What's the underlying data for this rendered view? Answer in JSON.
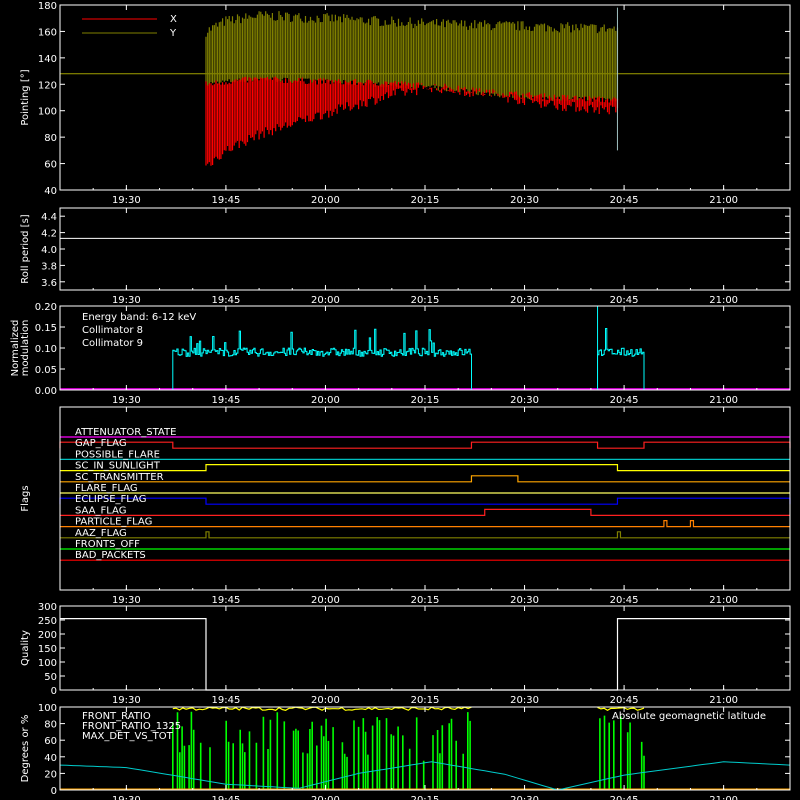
{
  "x_ticks": [
    "19:30",
    "19:45",
    "20:00",
    "20:15",
    "20:30",
    "20:45",
    "21:00"
  ],
  "chart_data": [
    {
      "type": "line",
      "title": "",
      "ylabel": "Pointing [°]",
      "ylim": [
        40,
        180
      ],
      "y_ticks": [
        "40",
        "60",
        "80",
        "100",
        "120",
        "140",
        "160",
        "180"
      ],
      "legend": "top-left",
      "series": [
        {
          "name": "X",
          "color": "#ff0000",
          "x": [
            "19:42",
            "19:45",
            "19:50",
            "20:00",
            "20:10",
            "20:16",
            "20:25",
            "20:35",
            "20:44"
          ],
          "y_upper": [
            120,
            122,
            124,
            122,
            121,
            118,
            114,
            110,
            108
          ],
          "y_lower": [
            58,
            70,
            82,
            98,
            112,
            118,
            112,
            104,
            100
          ]
        },
        {
          "name": "Y",
          "color": "#808000",
          "x": [
            "19:42",
            "19:45",
            "19:50",
            "20:00",
            "20:15",
            "20:30",
            "20:44"
          ],
          "y_upper": [
            160,
            168,
            172,
            170,
            166,
            164,
            162
          ],
          "y_lower": [
            120,
            122,
            124,
            122,
            118,
            110,
            108
          ]
        }
      ],
      "baseline": 128
    },
    {
      "type": "line",
      "ylabel": "Roll period [s]",
      "ylim": [
        3.5,
        4.5
      ],
      "y_ticks": [
        "3.6",
        "3.8",
        "4.0",
        "4.2",
        "4.4"
      ],
      "series": [
        {
          "name": "",
          "color": "#ffffff",
          "x": [
            "19:20",
            "21:10"
          ],
          "y": [
            4.13,
            4.13
          ]
        }
      ]
    },
    {
      "type": "line",
      "ylabel": "Normalized modulation",
      "ylim": [
        0,
        0.2
      ],
      "y_ticks": [
        "0.00",
        "0.05",
        "0.10",
        "0.15",
        "0.20"
      ],
      "legend": "top-left",
      "annotation": "Energy band: 6-12 keV",
      "series": [
        {
          "name": "Collimator 8",
          "color": "#00ffff",
          "segments": [
            {
              "x": [
                "19:37",
                "20:22"
              ],
              "y_mean": 0.09
            },
            {
              "x": [
                "20:41",
                "20:48"
              ],
              "y_mean": 0.09
            }
          ]
        },
        {
          "name": "Collimator 9",
          "color": "#ff00ff",
          "x": [
            "19:20",
            "21:10"
          ],
          "y": [
            0,
            0
          ]
        }
      ]
    },
    {
      "type": "table",
      "ylabel": "Flags",
      "flags": [
        {
          "name": "ATTENUATOR_STATE",
          "color": "#ff00ff",
          "on": []
        },
        {
          "name": "GAP_FLAG",
          "color": "#ff2020",
          "on": [
            [
              "19:20",
              "19:37"
            ],
            [
              "20:22",
              "20:41"
            ],
            [
              "20:48",
              "21:10"
            ]
          ]
        },
        {
          "name": "POSSIBLE_FLARE",
          "color": "#00c0c0",
          "on": []
        },
        {
          "name": "SC_IN_SUNLIGHT",
          "color": "#ffff00",
          "on": [
            [
              "19:42",
              "20:44"
            ]
          ]
        },
        {
          "name": "SC_TRANSMITTER",
          "color": "#ffa500",
          "on": [
            [
              "20:22",
              "20:29"
            ]
          ]
        },
        {
          "name": "FLARE_FLAG",
          "color": "#ffff60",
          "on": []
        },
        {
          "name": "ECLIPSE_FLAG",
          "color": "#0000ff",
          "on": [
            [
              "19:20",
              "19:42"
            ],
            [
              "20:44",
              "21:10"
            ]
          ]
        },
        {
          "name": "SAA_FLAG",
          "color": "#ff2020",
          "on": [
            [
              "20:24",
              "20:40"
            ]
          ]
        },
        {
          "name": "PARTICLE_FLAG",
          "color": "#ff8000",
          "on": [
            [
              "20:51",
              "20:51"
            ],
            [
              "20:55",
              "20:55"
            ]
          ]
        },
        {
          "name": "AAZ_FLAG",
          "color": "#808000",
          "on": [
            [
              "19:42",
              "19:42"
            ],
            [
              "20:44",
              "20:44"
            ]
          ]
        },
        {
          "name": "FRONTS_OFF",
          "color": "#00ff00",
          "on": []
        },
        {
          "name": "BAD_PACKETS",
          "color": "#ff0000",
          "on": []
        }
      ]
    },
    {
      "type": "line",
      "ylabel": "Quality",
      "ylim": [
        0,
        300
      ],
      "y_ticks": [
        "0",
        "50",
        "100",
        "150",
        "200",
        "250",
        "300"
      ],
      "series": [
        {
          "name": "",
          "color": "#ffffff",
          "x": [
            "19:20",
            "19:42",
            "19:42",
            "20:44",
            "20:44",
            "21:10"
          ],
          "y": [
            255,
            255,
            0,
            0,
            255,
            255
          ]
        }
      ]
    },
    {
      "type": "bar",
      "ylabel": "Degrees or %",
      "ylim": [
        0,
        100
      ],
      "y_ticks": [
        "0",
        "20",
        "40",
        "60",
        "80",
        "100"
      ],
      "legend": "top-left",
      "annotation": "Absolute geomagnetic latitude",
      "series": [
        {
          "name": "FRONT_RATIO",
          "color": "#ffff00",
          "segments": [
            [
              "19:37",
              "20:22"
            ],
            [
              "20:41",
              "20:48"
            ]
          ],
          "y": 98
        },
        {
          "name": "FRONT_RATIO_1325",
          "color": "#00ff00",
          "segments": [
            [
              "19:37",
              "20:22"
            ],
            [
              "20:41",
              "20:48"
            ]
          ],
          "y_max": 95
        },
        {
          "name": "MAX_DET_VS_TOT",
          "color": "#ffa500",
          "y": 0
        },
        {
          "name": "Absolute geomagnetic latitude",
          "color": "#00cccc",
          "x": [
            "19:20",
            "19:30",
            "19:45",
            "19:56",
            "20:05",
            "20:16",
            "20:27",
            "20:35",
            "20:45",
            "21:00",
            "21:10"
          ],
          "y": [
            30,
            27,
            7,
            2,
            20,
            34,
            19,
            0,
            18,
            34,
            30
          ]
        }
      ]
    }
  ]
}
